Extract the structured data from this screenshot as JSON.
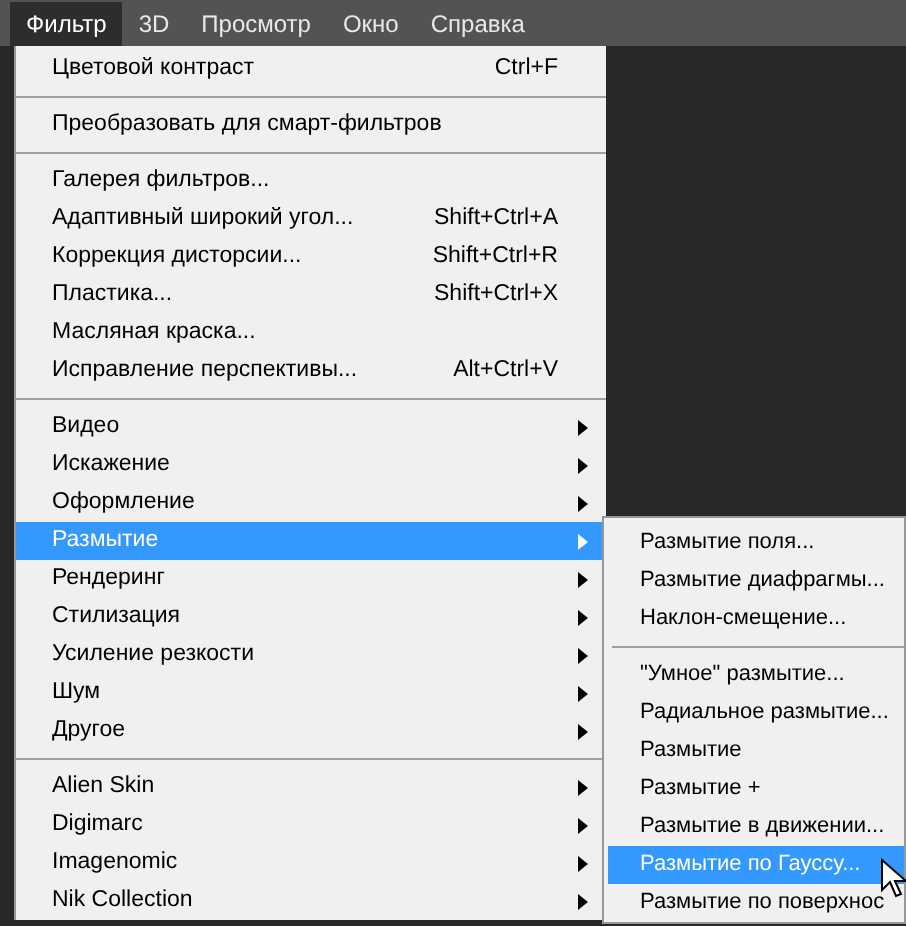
{
  "menubar": [
    {
      "label": "Фильтр",
      "selected": true
    },
    {
      "label": "3D",
      "selected": false
    },
    {
      "label": "Просмотр",
      "selected": false
    },
    {
      "label": "Окно",
      "selected": false
    },
    {
      "label": "Справка",
      "selected": false
    }
  ],
  "menu": [
    {
      "kind": "item",
      "label": "Цветовой контраст",
      "shortcut": "Ctrl+F",
      "has_submenu": false,
      "selected": false
    },
    {
      "kind": "separator"
    },
    {
      "kind": "item",
      "label": "Преобразовать для смарт-фильтров",
      "has_submenu": false,
      "selected": false
    },
    {
      "kind": "separator"
    },
    {
      "kind": "item",
      "label": "Галерея фильтров...",
      "has_submenu": false,
      "selected": false
    },
    {
      "kind": "item",
      "label": "Адаптивный широкий угол...",
      "shortcut": "Shift+Ctrl+A",
      "has_submenu": false,
      "selected": false
    },
    {
      "kind": "item",
      "label": "Коррекция дисторсии...",
      "shortcut": "Shift+Ctrl+R",
      "has_submenu": false,
      "selected": false
    },
    {
      "kind": "item",
      "label": "Пластика...",
      "shortcut": "Shift+Ctrl+X",
      "has_submenu": false,
      "selected": false
    },
    {
      "kind": "item",
      "label": "Масляная краска...",
      "has_submenu": false,
      "selected": false
    },
    {
      "kind": "item",
      "label": "Исправление перспективы...",
      "shortcut": "Alt+Ctrl+V",
      "has_submenu": false,
      "selected": false
    },
    {
      "kind": "separator"
    },
    {
      "kind": "item",
      "label": "Видео",
      "has_submenu": true,
      "selected": false
    },
    {
      "kind": "item",
      "label": "Искажение",
      "has_submenu": true,
      "selected": false
    },
    {
      "kind": "item",
      "label": "Оформление",
      "has_submenu": true,
      "selected": false
    },
    {
      "kind": "item",
      "label": "Размытие",
      "has_submenu": true,
      "selected": true
    },
    {
      "kind": "item",
      "label": "Рендеринг",
      "has_submenu": true,
      "selected": false
    },
    {
      "kind": "item",
      "label": "Стилизация",
      "has_submenu": true,
      "selected": false
    },
    {
      "kind": "item",
      "label": "Усиление резкости",
      "has_submenu": true,
      "selected": false
    },
    {
      "kind": "item",
      "label": "Шум",
      "has_submenu": true,
      "selected": false
    },
    {
      "kind": "item",
      "label": "Другое",
      "has_submenu": true,
      "selected": false
    },
    {
      "kind": "separator"
    },
    {
      "kind": "item",
      "label": "Alien Skin",
      "has_submenu": true,
      "selected": false
    },
    {
      "kind": "item",
      "label": "Digimarc",
      "has_submenu": true,
      "selected": false
    },
    {
      "kind": "item",
      "label": "Imagenomic",
      "has_submenu": true,
      "selected": false
    },
    {
      "kind": "item",
      "label": "Nik Collection",
      "has_submenu": true,
      "selected": false
    }
  ],
  "submenu": [
    {
      "kind": "item",
      "label": "Размытие поля...",
      "selected": false
    },
    {
      "kind": "item",
      "label": "Размытие диафрагмы...",
      "selected": false
    },
    {
      "kind": "item",
      "label": "Наклон-смещение...",
      "selected": false
    },
    {
      "kind": "separator"
    },
    {
      "kind": "item",
      "label": "\"Умное\" размытие...",
      "selected": false
    },
    {
      "kind": "item",
      "label": "Радиальное размытие...",
      "selected": false
    },
    {
      "kind": "item",
      "label": "Размытие",
      "selected": false
    },
    {
      "kind": "item",
      "label": "Размытие +",
      "selected": false
    },
    {
      "kind": "item",
      "label": "Размытие в движении...",
      "selected": false
    },
    {
      "kind": "item",
      "label": "Размытие по Гауссу...",
      "selected": true
    },
    {
      "kind": "item",
      "label": "Размытие по поверхнос",
      "selected": false
    }
  ]
}
